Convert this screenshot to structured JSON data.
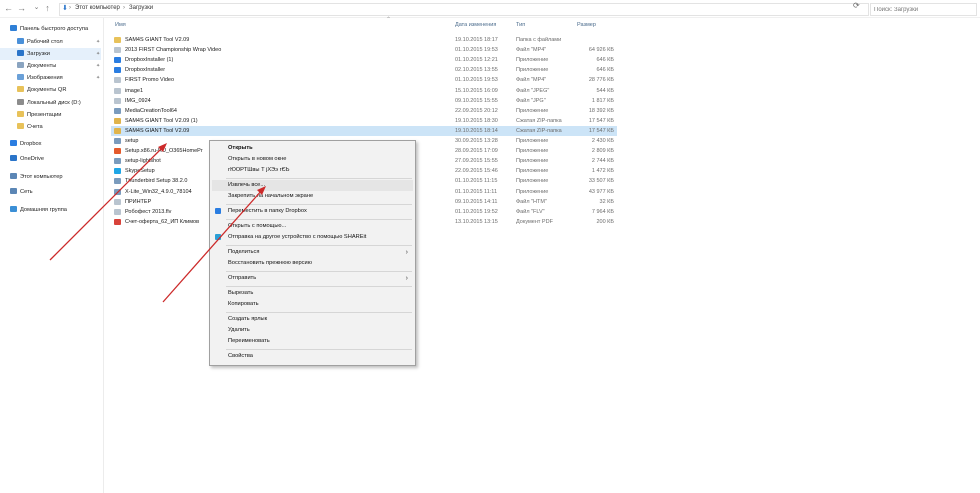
{
  "address_bar": {
    "back": "←",
    "forward": "→",
    "recent": "⌄",
    "up": "↑",
    "path": [
      "Этот компьютер",
      "Загрузки"
    ],
    "search_placeholder": "Поиск: Загрузки"
  },
  "nav": {
    "items": [
      {
        "label": "Панель быстрого доступа",
        "color": "#2f7fd6",
        "pinned": false,
        "selected": false
      },
      {
        "label": "Рабочий стол",
        "color": "#4a90d9",
        "pinned": true,
        "selected": false
      },
      {
        "label": "Загрузки",
        "color": "#2a74c9",
        "pinned": true,
        "selected": true
      },
      {
        "label": "Документы",
        "color": "#8aa4c0",
        "pinned": true,
        "selected": false
      },
      {
        "label": "Изображения",
        "color": "#6aa0d8",
        "pinned": true,
        "selected": false
      },
      {
        "label": "Документы QR",
        "color": "#e8c25a",
        "pinned": false,
        "selected": false
      },
      {
        "label": "Локальный диск (D:)",
        "color": "#8c8c8c",
        "pinned": false,
        "selected": false
      },
      {
        "label": "Презентации",
        "color": "#e8c25a",
        "pinned": false,
        "selected": false
      },
      {
        "label": "Счета",
        "color": "#e8c25a",
        "pinned": false,
        "selected": false
      },
      {
        "label": "Dropbox",
        "color": "#2a7de1",
        "pinned": false,
        "selected": false
      },
      {
        "label": "OneDrive",
        "color": "#2a74c9",
        "pinned": false,
        "selected": false
      },
      {
        "label": "Этот компьютер",
        "color": "#5b86b5",
        "pinned": false,
        "selected": false
      },
      {
        "label": "Сеть",
        "color": "#5b86b5",
        "pinned": false,
        "selected": false
      },
      {
        "label": "Домашняя группа",
        "color": "#3b8fd6",
        "pinned": false,
        "selected": false
      }
    ]
  },
  "columns": {
    "name": "Имя",
    "date": "Дата изменения",
    "type": "Тип",
    "size": "Размер"
  },
  "files": [
    {
      "name": "SAM4S GIANT Tool V2.09",
      "date": "19.10.2015 18:17",
      "type": "Папка с файлами",
      "size": "",
      "icon": "folder"
    },
    {
      "name": "2013 FIRST Championship Wrap Video",
      "date": "01.10.2015 19:53",
      "type": "Файл \"MP4\"",
      "size": "64 926 КБ",
      "icon": "file"
    },
    {
      "name": "DropboxInstaller (1)",
      "date": "01.10.2015 12:21",
      "type": "Приложение",
      "size": "646 КБ",
      "icon": "dropbox"
    },
    {
      "name": "DropboxInstaller",
      "date": "02.10.2015 13:55",
      "type": "Приложение",
      "size": "646 КБ",
      "icon": "dropbox"
    },
    {
      "name": "FIRST Promo Video",
      "date": "01.10.2015 19:53",
      "type": "Файл \"MP4\"",
      "size": "28 776 КБ",
      "icon": "file"
    },
    {
      "name": "image1",
      "date": "15.10.2015 16:09",
      "type": "Файл \"JPEG\"",
      "size": "544 КБ",
      "icon": "file"
    },
    {
      "name": "IMG_0924",
      "date": "09.10.2015 15:55",
      "type": "Файл \"JPG\"",
      "size": "1 817 КБ",
      "icon": "file"
    },
    {
      "name": "MediaCreationTool64",
      "date": "22.09.2015 20:12",
      "type": "Приложение",
      "size": "18 392 КБ",
      "icon": "app"
    },
    {
      "name": "SAM4S GIANT Tool V2.09 (1)",
      "date": "19.10.2015 18:30",
      "type": "Сжатая ZIP-папка",
      "size": "17 547 КБ",
      "icon": "zip"
    },
    {
      "name": "SAM4S GIANT Tool V2.09",
      "date": "19.10.2015 18:14",
      "type": "Сжатая ZIP-папка",
      "size": "17 547 КБ",
      "icon": "zip",
      "selected": true
    },
    {
      "name": "setup",
      "date": "30.09.2015 13:28",
      "type": "Приложение",
      "size": "2 430 КБ",
      "icon": "app"
    },
    {
      "name": "Setup.x86.ru-RU_O365HomePr",
      "date": "28.09.2015 17:09",
      "type": "Приложение",
      "size": "2 809 КБ",
      "icon": "office"
    },
    {
      "name": "setup-lightshot",
      "date": "27.09.2015 15:55",
      "type": "Приложение",
      "size": "2 744 КБ",
      "icon": "app"
    },
    {
      "name": "SkypeSetup",
      "date": "22.09.2015 15:46",
      "type": "Приложение",
      "size": "1 472 КБ",
      "icon": "skype"
    },
    {
      "name": "Thunderbird Setup 38.2.0",
      "date": "01.10.2015 11:15",
      "type": "Приложение",
      "size": "33 507 КБ",
      "icon": "app"
    },
    {
      "name": "X-Lite_Win32_4.9.0_78104",
      "date": "01.10.2015 11:11",
      "type": "Приложение",
      "size": "43 977 КБ",
      "icon": "app"
    },
    {
      "name": "ПРИНТЕР",
      "date": "09.10.2015 14:11",
      "type": "Файл \"HTM\"",
      "size": "32 КБ",
      "icon": "file"
    },
    {
      "name": "Робофест 2013.flv",
      "date": "01.10.2015 19:52",
      "type": "Файл \"FLV\"",
      "size": "7 964 КБ",
      "icon": "file"
    },
    {
      "name": "Счет-оферта_62_ИП Климов",
      "date": "13.10.2015 13:15",
      "type": "Документ PDF",
      "size": "200 КБ",
      "icon": "pdf"
    }
  ],
  "context_menu": {
    "items": [
      {
        "label": "Открыть",
        "bold": true
      },
      {
        "label": "Открыть в новом окне"
      },
      {
        "label": "гЮОРТШвы Т јХЭэ гЄЬ"
      },
      {
        "separator": true
      },
      {
        "label": "Извлечь все...",
        "highlight": true
      },
      {
        "label": "Закрепить на начальном экране"
      },
      {
        "separator": true
      },
      {
        "label": "Переместить в папку Dropbox",
        "icon": "#2a7de1"
      },
      {
        "separator": true
      },
      {
        "label": "Открыть с помощью..."
      },
      {
        "label": "Отправка на другое устройство с помощью SHAREit",
        "icon": "#2a9fd6"
      },
      {
        "separator": true
      },
      {
        "label": "Поделиться",
        "submenu": true
      },
      {
        "label": "Восстановить прежнюю версию"
      },
      {
        "separator": true
      },
      {
        "label": "Отправить",
        "submenu": true
      },
      {
        "separator": true
      },
      {
        "label": "Вырезать"
      },
      {
        "label": "Копировать"
      },
      {
        "separator": true
      },
      {
        "label": "Создать ярлык"
      },
      {
        "label": "Удалить"
      },
      {
        "label": "Переименовать"
      },
      {
        "separator": true
      },
      {
        "label": "Свойства"
      }
    ]
  },
  "colors": {
    "annotation_arrow": "#cc2a2a",
    "selection": "#cce4f7",
    "hover": "#e5f0fb"
  }
}
